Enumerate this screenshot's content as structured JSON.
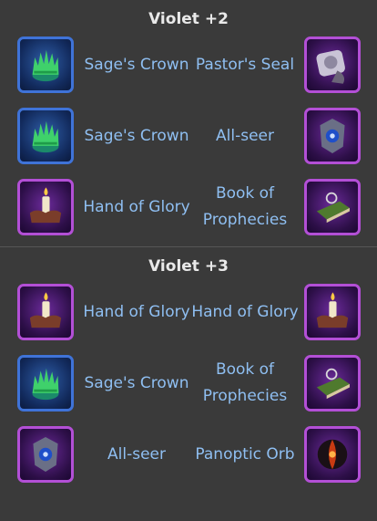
{
  "sections": [
    {
      "title": "Violet +2",
      "rows": [
        {
          "left": {
            "label": "Sage's Crown",
            "icon": "sages-crown-icon",
            "frame": "blue"
          },
          "right": {
            "label": "Pastor's Seal",
            "icon": "pastors-seal-icon",
            "frame": "purple"
          }
        },
        {
          "left": {
            "label": "Sage's Crown",
            "icon": "sages-crown-icon",
            "frame": "blue"
          },
          "right": {
            "label": "All-seer",
            "icon": "all-seer-icon",
            "frame": "purple"
          }
        },
        {
          "left": {
            "label": "Hand of Glory",
            "icon": "hand-of-glory-icon",
            "frame": "purple"
          },
          "right": {
            "label": "Book of Prophecies",
            "icon": "book-of-prophecies-icon",
            "frame": "purple"
          }
        }
      ]
    },
    {
      "title": "Violet +3",
      "rows": [
        {
          "left": {
            "label": "Hand of Glory",
            "icon": "hand-of-glory-icon",
            "frame": "purple"
          },
          "right": {
            "label": "Hand of Glory",
            "icon": "hand-of-glory-icon",
            "frame": "purple"
          }
        },
        {
          "left": {
            "label": "Sage's Crown",
            "icon": "sages-crown-icon",
            "frame": "blue"
          },
          "right": {
            "label": "Book of Prophecies",
            "icon": "book-of-prophecies-icon",
            "frame": "purple"
          }
        },
        {
          "left": {
            "label": "All-seer",
            "icon": "all-seer-icon",
            "frame": "purple"
          },
          "right": {
            "label": "Panoptic Orb",
            "icon": "panoptic-orb-icon",
            "frame": "purple"
          }
        }
      ]
    }
  ]
}
